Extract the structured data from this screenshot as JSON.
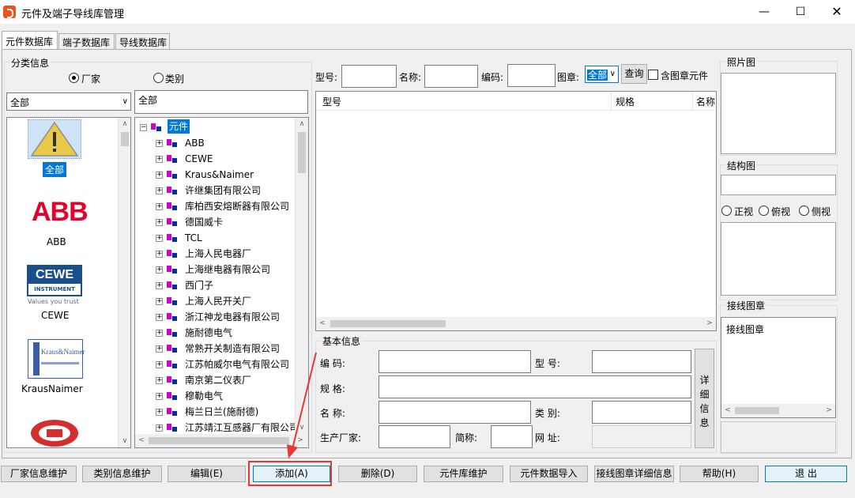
{
  "window": {
    "title": "元件及端子导线库管理"
  },
  "tabs": [
    {
      "label": "元件数据库"
    },
    {
      "label": "端子数据库"
    },
    {
      "label": "导线数据库"
    }
  ],
  "classify": {
    "group_label": "分类信息",
    "radio_vendor": "厂家",
    "radio_category": "类别",
    "vendor_combo_value": "全部",
    "path_value": "全部"
  },
  "logos": [
    {
      "label": "全部"
    },
    {
      "label": "ABB",
      "logo_text": "ABB"
    },
    {
      "label": "CEWE",
      "logo_line1": "CEWE",
      "logo_line2": "INSTRUMENT",
      "logo_line3": "Values you trust"
    },
    {
      "label": "KrausNaimer",
      "logo_text": "Kraus&Naimer"
    }
  ],
  "tree": {
    "root": "元件",
    "items": [
      "ABB",
      "CEWE",
      "Kraus&Naimer",
      "许继集团有限公司",
      "库柏西安熔断器有限公司",
      "德国威卡",
      "TCL",
      "上海人民电器厂",
      "上海继电器有限公司",
      "西门子",
      "上海人民开关厂",
      "浙江神龙电器有限公司",
      "施耐德电气",
      "常熟开关制造有限公司",
      "江苏帕威尔电气有限公司",
      "南京第二仪表厂",
      "穆勒电气",
      "梅兰日兰(施耐德)",
      "江苏靖江互感器厂有限公司"
    ]
  },
  "search": {
    "model_label": "型号:",
    "name_label": "名称:",
    "code_label": "编码:",
    "stamp_label": "图章:",
    "stamp_value": "全部",
    "query_button": "查询",
    "include_stamp_label": "含图章元件"
  },
  "results_table": {
    "columns": [
      "型号",
      "规格",
      "名称"
    ]
  },
  "basic_info": {
    "group_label": "基本信息",
    "code_label": "编   码:",
    "model_label": "型   号:",
    "spec_label": "规   格:",
    "name_label": "名   称:",
    "category_label": "类   别:",
    "manufacturer_label": "生产厂家:",
    "short_label": "简称:",
    "url_label": "网   址:",
    "detail_button": "详细信息"
  },
  "side": {
    "photo_label": "照片图",
    "structure_label": "结构图",
    "view_front": "正视",
    "view_top": "俯视",
    "view_side": "侧视",
    "wiring_group_label": "接线图章",
    "wiring_list_item": "接线图章"
  },
  "buttons": {
    "vendor_maint": "厂家信息维护",
    "category_maint": "类别信息维护",
    "edit": "编辑(E)",
    "add": "添加(A)",
    "delete": "删除(D)",
    "lib_maint": "元件库维护",
    "import": "元件数据导入",
    "stamp_detail": "接线图章详细信息",
    "help": "帮助(H)",
    "exit": "退      出"
  },
  "colors": {
    "accent": "#0078d7",
    "highlight_box": "#e53935",
    "abb_red": "#e4002b",
    "cewe_blue": "#1a4f8b",
    "kn_blue": "#3a5da8",
    "xj_red": "#d32f2f"
  }
}
